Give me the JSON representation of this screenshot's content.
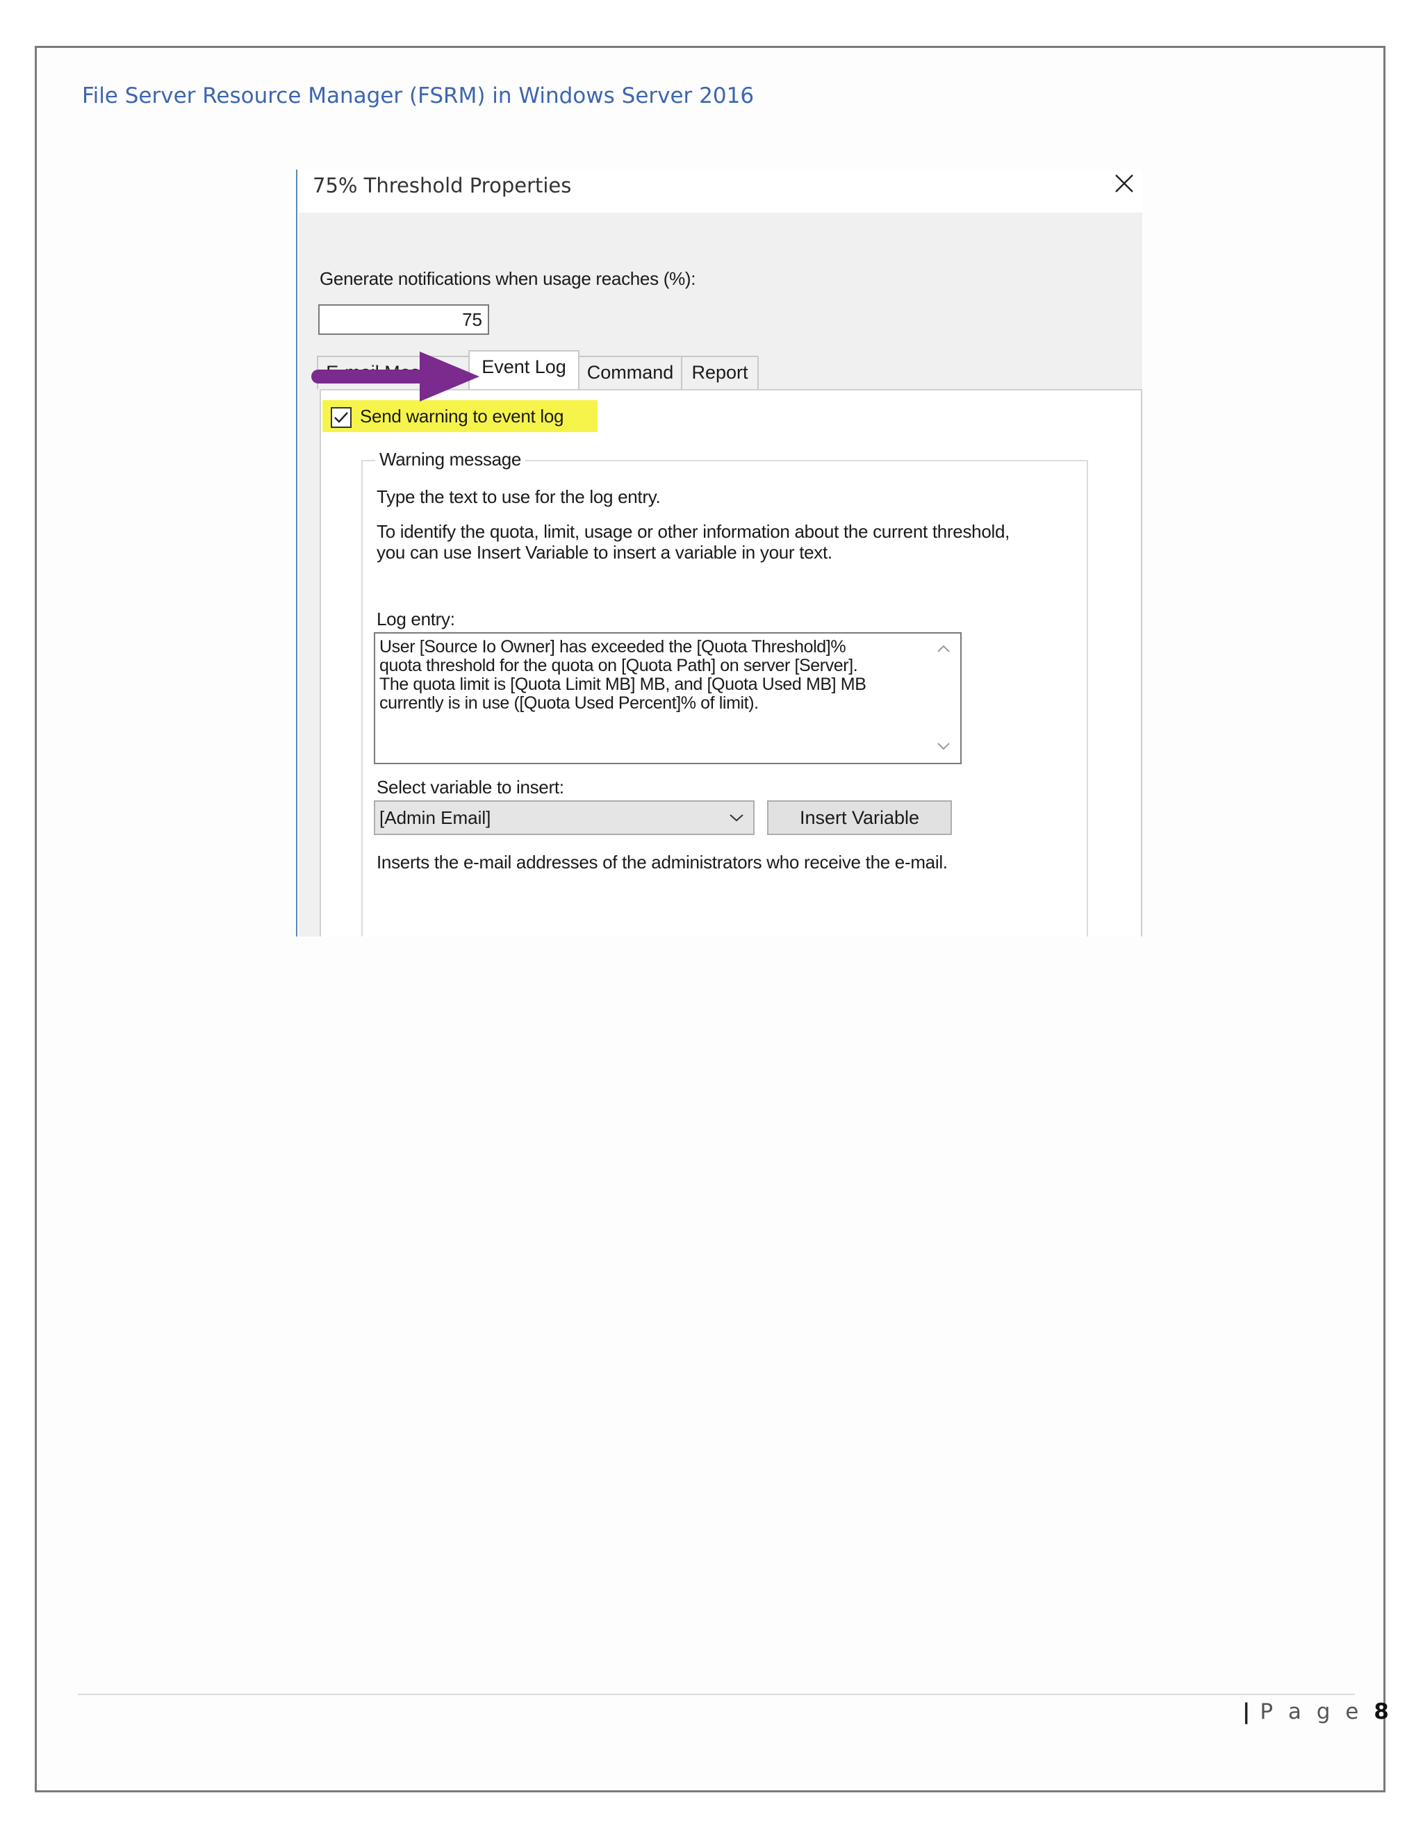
{
  "document": {
    "header": "File Server Resource Manager (FSRM) in Windows Server 2016",
    "footer_label": "P a g e",
    "footer_page": "8"
  },
  "dialog": {
    "title": "75% Threshold Properties",
    "usage_label": "Generate notifications when usage reaches (%):",
    "usage_value": "75",
    "tabs": [
      {
        "label": "E-mail Message",
        "active": false
      },
      {
        "label": "Event Log",
        "active": true
      },
      {
        "label": "Command",
        "active": false
      },
      {
        "label": "Report",
        "active": false
      }
    ],
    "send_warning_label": "Send warning to event log",
    "send_warning_checked": true,
    "warning_group_label": "Warning message",
    "instructions_1": "Type the text to use for the log entry.",
    "instructions_2a": "To identify the quota, limit, usage or other information about the current threshold,",
    "instructions_2b": "you can use Insert Variable to insert a variable in your text.",
    "log_entry_label": "Log entry:",
    "log_entry_text": "User [Source Io Owner] has exceeded the [Quota Threshold]%\nquota threshold for the quota on [Quota Path] on server [Server].\nThe quota limit is [Quota Limit MB] MB, and [Quota Used MB] MB\ncurrently is in use ([Quota Used Percent]% of limit).",
    "select_variable_label": "Select variable to insert:",
    "select_variable_value": "[Admin Email]",
    "insert_variable_button": "Insert Variable",
    "variable_description": "Inserts the e-mail addresses of the administrators who receive the e-mail."
  },
  "annotation": {
    "arrow_color": "#7b2a8e",
    "highlight_color": "#f6f44a"
  }
}
